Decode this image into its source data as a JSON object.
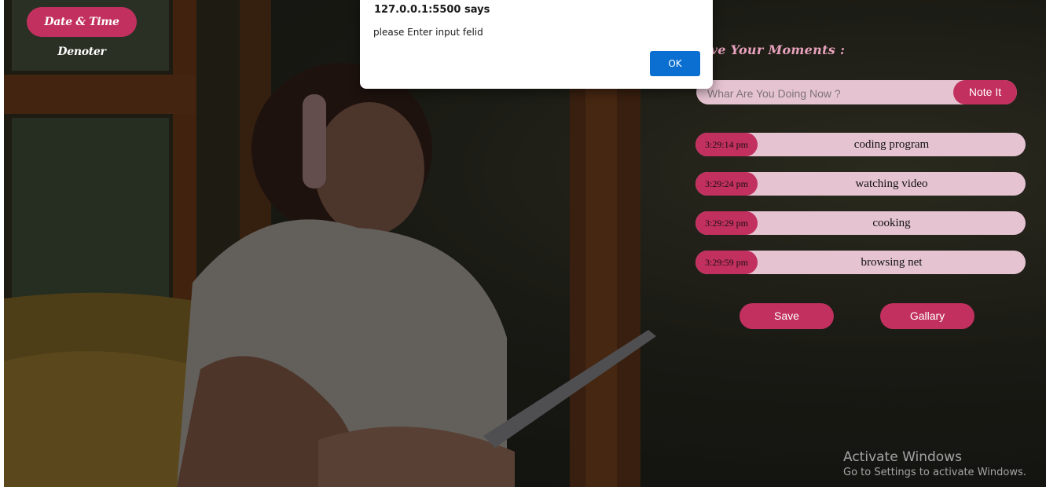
{
  "brand": {
    "label": "Date & Time Denoter"
  },
  "heading": {
    "text": "ave Your Moments :"
  },
  "note_input": {
    "placeholder": "Whar Are You Doing Now ?",
    "value": ""
  },
  "note_button": {
    "label": "Note It"
  },
  "entries": [
    {
      "time": "3:29:14 pm",
      "activity": "coding program"
    },
    {
      "time": "3:29:24 pm",
      "activity": "watching video"
    },
    {
      "time": "3:29:29 pm",
      "activity": "cooking"
    },
    {
      "time": "3:29:59 pm",
      "activity": "browsing net"
    }
  ],
  "actions": {
    "save_label": "Save",
    "gallery_label": "Gallary"
  },
  "dialog": {
    "title": "127.0.0.1:5500 says",
    "message": "please Enter input felid",
    "ok_label": "OK"
  },
  "watermark": {
    "title": "Activate Windows",
    "subtitle": "Go to Settings to activate Windows."
  },
  "colors": {
    "accent": "#c2305f",
    "pill_bg": "#e5c3d1",
    "heading": "#e9a2bd",
    "dialog_button": "#0b6fd1"
  }
}
